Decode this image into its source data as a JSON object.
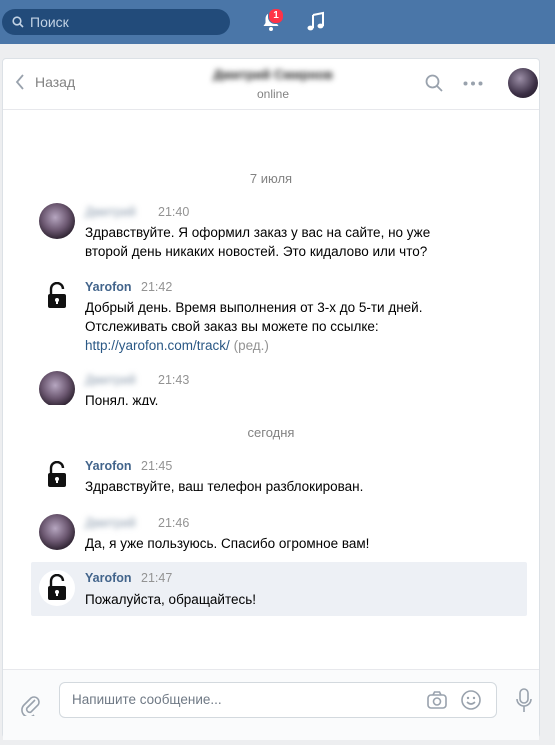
{
  "topbar": {
    "search_placeholder": "Поиск",
    "notifications_count": "1"
  },
  "chat": {
    "back_label": "Назад",
    "contact_name": "Дмитрий Смирнов",
    "status": "online"
  },
  "messages": [
    {
      "author": "Дмитрий",
      "time": "21:40",
      "lines": [
        "Здравствуйте. Я оформил заказ у вас на сайте, но уже",
        "второй день никаких новостей. Это кидалово или что?"
      ]
    },
    {
      "author": "Yarofon",
      "time": "21:42",
      "lines": [
        "Добрый день. Время выполнения от 3-х до 5-ти дней.",
        "Отслеживать свой заказ вы можете по ссылке:"
      ],
      "link": "http://yarofon.com/track/",
      "edited": "(ред.)"
    },
    {
      "author": "Дмитрий",
      "time": "21:43",
      "lines": [
        "Понял, жду."
      ]
    },
    {
      "author": "Yarofon",
      "time": "21:45",
      "lines": [
        "Здравствуйте, ваш телефон разблокирован."
      ]
    },
    {
      "author": "Дмитрий",
      "time": "21:46",
      "lines": [
        "Да, я уже пользуюсь. Спасибо огромное вам!"
      ]
    },
    {
      "author": "Yarofon",
      "time": "21:47",
      "lines": [
        "Пожалуйста, обращайтесь!"
      ]
    }
  ],
  "dates": {
    "first": "7 июля",
    "second": "сегодня"
  },
  "composer": {
    "placeholder": "Напишите сообщение..."
  },
  "colors": {
    "topbar": "#4a76a8",
    "link": "#2a5885",
    "author": "#42648b",
    "highlight": "#edf0f5"
  }
}
